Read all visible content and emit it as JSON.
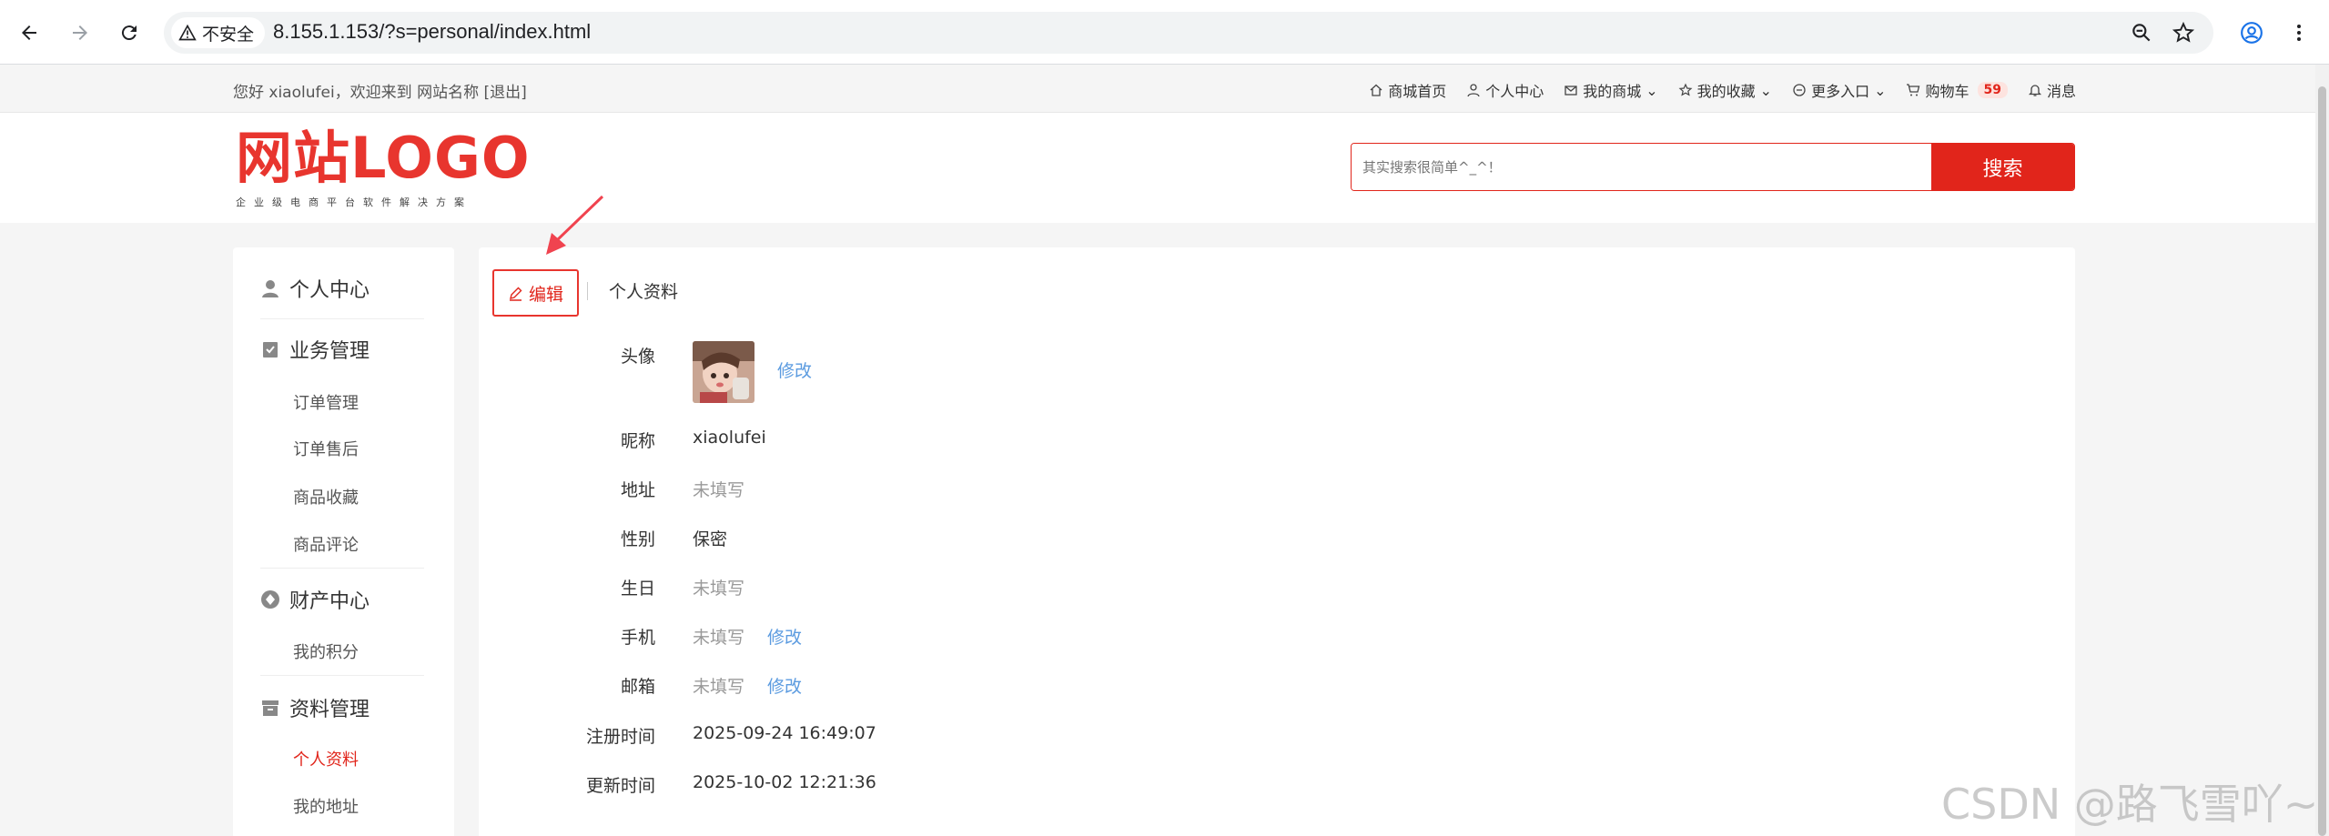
{
  "browser": {
    "security_label": "不安全",
    "url": "8.155.1.153/?s=personal/index.html",
    "icons": [
      "back-icon",
      "forward-icon",
      "reload-icon",
      "warning-icon",
      "zoom-icon",
      "star-icon",
      "profile-icon",
      "more-icon"
    ]
  },
  "topbar": {
    "welcome": "您好 xiaolufei，欢迎来到 网站名称 [退出]",
    "links": [
      {
        "icon": "home-icon",
        "label": "商城首页"
      },
      {
        "icon": "user-icon",
        "label": "个人中心"
      },
      {
        "icon": "mail-icon",
        "label": "我的商城"
      },
      {
        "icon": "star-icon",
        "label": "我的收藏"
      },
      {
        "icon": "more-circle-icon",
        "label": "更多入口"
      },
      {
        "icon": "cart-icon",
        "label": "购物车"
      },
      {
        "icon": "bell-icon",
        "label": "消息"
      }
    ],
    "cart_count": "59"
  },
  "header": {
    "logo_main": "网站LOGO",
    "logo_sub": "企业级电商平台软件解决方案",
    "search_placeholder": "其实搜索很简单^_^！",
    "search_button": "搜索"
  },
  "sidebar": {
    "personal_center": "个人中心",
    "business": "业务管理",
    "business_items": [
      "订单管理",
      "订单售后",
      "商品收藏",
      "商品评论"
    ],
    "finance": "财产中心",
    "finance_items": [
      "我的积分"
    ],
    "profile": "资料管理",
    "profile_items": [
      "个人资料",
      "我的地址"
    ]
  },
  "main": {
    "edit_label": "编辑",
    "tab_title": "个人资料",
    "rows": [
      {
        "label": "头像",
        "value": "",
        "link": "修改"
      },
      {
        "label": "昵称",
        "value": "xiaolufei"
      },
      {
        "label": "地址",
        "value": "未填写"
      },
      {
        "label": "性别",
        "value": "保密"
      },
      {
        "label": "生日",
        "value": "未填写"
      },
      {
        "label": "手机",
        "value": "未填写",
        "link": "修改"
      },
      {
        "label": "邮箱",
        "value": "未填写",
        "link": "修改"
      },
      {
        "label": "注册时间",
        "value": "2025-09-24 16:49:07"
      },
      {
        "label": "更新时间",
        "value": "2025-10-02 12:21:36"
      }
    ]
  },
  "watermark": "CSDN @路飞雪吖~",
  "colors": {
    "accent": "#e1251b",
    "link": "#5b9be0"
  }
}
